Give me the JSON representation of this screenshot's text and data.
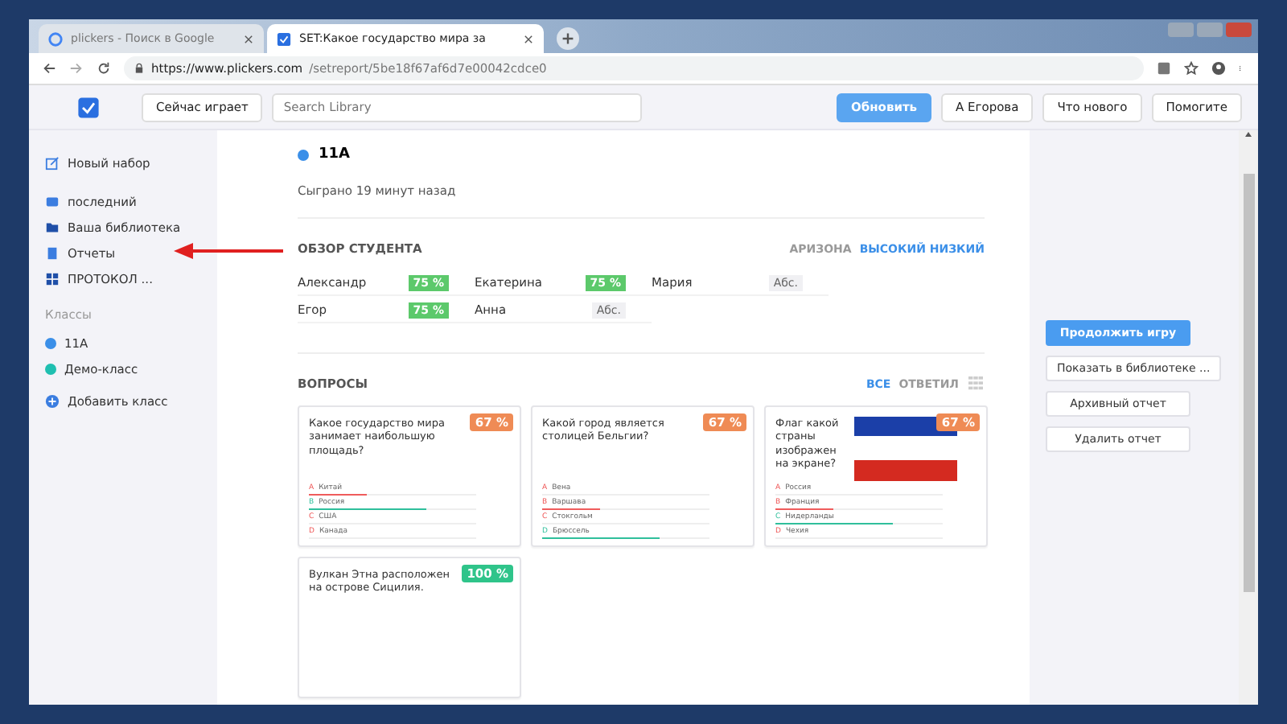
{
  "browser": {
    "tabs": [
      {
        "title": "plickers - Поиск в Google",
        "selected": false
      },
      {
        "title": "SET:Какое государство мира за",
        "selected": true
      }
    ],
    "url_host": "https://www.plickers.com",
    "url_path": "/setreport/5be18f67af6d7e00042cdce0"
  },
  "header": {
    "now_playing": "Сейчас играет",
    "search": {
      "placeholder": "Search Library"
    },
    "refresh": "Обновить",
    "user": "А Егорова",
    "whats_new": "Что нового",
    "help": "Помогите"
  },
  "sidebar": {
    "new_set": "Новый набор",
    "items": [
      {
        "label": "последний"
      },
      {
        "label": "Ваша библиотека"
      },
      {
        "label": "Отчеты"
      },
      {
        "label": "ПРОТОКОЛ ..."
      }
    ],
    "classes_title": "Классы",
    "classes": [
      {
        "label": "11A",
        "color": "#3b8fe8"
      },
      {
        "label": "Демо-класс",
        "color": "#1fbfb0"
      }
    ],
    "add_class": "Добавить класс"
  },
  "report": {
    "class_name": "11A",
    "played": "Сыграно 19 минут назад",
    "overview_title": "ОБЗОР СТУДЕНТА",
    "sort_az": "АРИЗОНА",
    "sort_high_low": "ВЫСОКИЙ НИЗКИЙ",
    "students": [
      {
        "name": "Александр",
        "score": "75 %",
        "absent": false
      },
      {
        "name": "Екатерина",
        "score": "75 %",
        "absent": false
      },
      {
        "name": "Мария",
        "score": "Абс.",
        "absent": true
      },
      {
        "name": "Егор",
        "score": "75 %",
        "absent": false
      },
      {
        "name": "Анна",
        "score": "Абс.",
        "absent": true
      }
    ],
    "questions_title": "ВОПРОСЫ",
    "filter_all": "ВСЕ",
    "filter_answered": "ОТВЕТИЛ",
    "questions": [
      {
        "kind": "text",
        "text": "Какое государство мира занимает наибольшую площадь?",
        "score": "67 %",
        "choices": [
          {
            "letter": "A",
            "text": "Китай",
            "correct": false,
            "level": 0.35
          },
          {
            "letter": "B",
            "text": "Россия",
            "correct": true,
            "level": 0.7
          },
          {
            "letter": "C",
            "text": "США",
            "correct": false
          },
          {
            "letter": "D",
            "text": "Канада",
            "correct": false
          }
        ]
      },
      {
        "kind": "text",
        "text": "Какой город является столицей Бельгии?",
        "score": "67 %",
        "choices": [
          {
            "letter": "A",
            "text": "Вена",
            "correct": false
          },
          {
            "letter": "B",
            "text": "Варшава",
            "correct": false,
            "level": 0.35
          },
          {
            "letter": "C",
            "text": "Стокгольм",
            "correct": false
          },
          {
            "letter": "D",
            "text": "Брюссель",
            "correct": true,
            "level": 0.7
          }
        ]
      },
      {
        "kind": "flag",
        "text": "Флаг какой страны изображен на экране?",
        "score": "67 %",
        "choices": [
          {
            "letter": "A",
            "text": "Россия",
            "correct": false
          },
          {
            "letter": "B",
            "text": "Франция",
            "correct": false,
            "level": 0.35
          },
          {
            "letter": "C",
            "text": "Нидерланды",
            "correct": true,
            "level": 0.7
          },
          {
            "letter": "D",
            "text": "Чехия",
            "correct": false
          }
        ]
      },
      {
        "kind": "text",
        "text": "Вулкан Этна расположен на острове Сицилия.",
        "score": "100 %"
      }
    ]
  },
  "actions": {
    "primary": "Продолжить игру",
    "others": [
      "Показать в библиотеке ...",
      "Архивный отчет",
      "Удалить отчет"
    ]
  }
}
